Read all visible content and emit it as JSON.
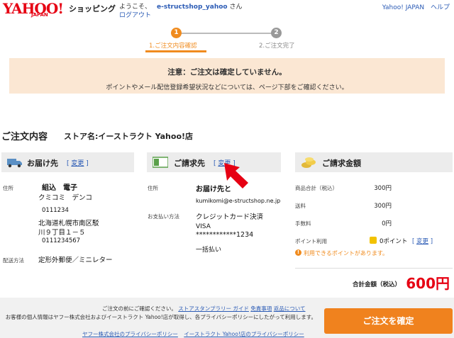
{
  "header": {
    "logo_text": "YAHOO!",
    "logo_sub": "JAPAN",
    "service": "ショッピング",
    "welcome": "ようこそ、",
    "username": "e-structshop_yahoo",
    "san": "さん",
    "logout": "ログアウト",
    "links": [
      "Yahoo! JAPAN",
      "ヘルプ"
    ]
  },
  "steps": [
    {
      "num": "1",
      "label": "1.ご注文内容確認"
    },
    {
      "num": "2",
      "label": "2.ご注文完了"
    }
  ],
  "notice": {
    "line1": "注意：ご注文は確定していません。",
    "line2": "ポイントやメール配信登録希望状況などについては、ページ下部をご確認ください。"
  },
  "order": {
    "title": "ご注文内容",
    "store": "ストア名:イーストラクト Yahoo!店"
  },
  "shipping": {
    "title": "お届け先",
    "change": "変更",
    "address_label": "住所",
    "name": "組込　電子",
    "kana": "クミコミ　デンコ",
    "zip": "0111234",
    "addr1": "北海道札幌市南区駁",
    "addr2": "川９丁目１－５",
    "phone": "0111234567",
    "method_label": "配送方法",
    "method": "定形外郵便／ミニレター"
  },
  "billing": {
    "title": "ご請求先",
    "change": "変更",
    "address_label": "住所",
    "address": "お届け先と",
    "email": "kumikomi@e-structshop.ne.jp",
    "payment_label": "お支払い方法",
    "payment": "クレジットカード決済",
    "card_brand": "VISA",
    "card_number": "************1234",
    "installments": "一括払い"
  },
  "amount": {
    "title": "ご請求金額",
    "rows": [
      {
        "label": "商品合計（税込）",
        "value": "300円"
      },
      {
        "label": "送料",
        "value": "300円"
      },
      {
        "label": "手数料",
        "value": "0円"
      }
    ],
    "points_label": "ポイント利用",
    "points_value": "0ポイント",
    "points_change": "変更",
    "warning": "利用できるポイントがあります。",
    "total_label": "合計金額（税込）",
    "total_value": "600円"
  },
  "footer": {
    "line1_text": "ご注文の前にご確認ください。",
    "line1_links": [
      "ストアスタンプラリー ガイド",
      "免責事項",
      "返品について"
    ],
    "line2": "お客様の個人情報はヤフー株式会社およびイーストラクト Yahoo!店が取得し、各プライバシーポリシーにしたがって利用します。",
    "line3_links": [
      "ヤフー株式会社のプライバシーポリシー",
      "イーストラクト Yahoo!店のプライバシーポリシー"
    ],
    "confirm_button": "ご注文を確定"
  },
  "colors": {
    "brand_red": "#e60013",
    "accent_orange": "#f08b1e",
    "link_blue": "#2b5bb5",
    "notice_bg": "#fbe7d3"
  }
}
